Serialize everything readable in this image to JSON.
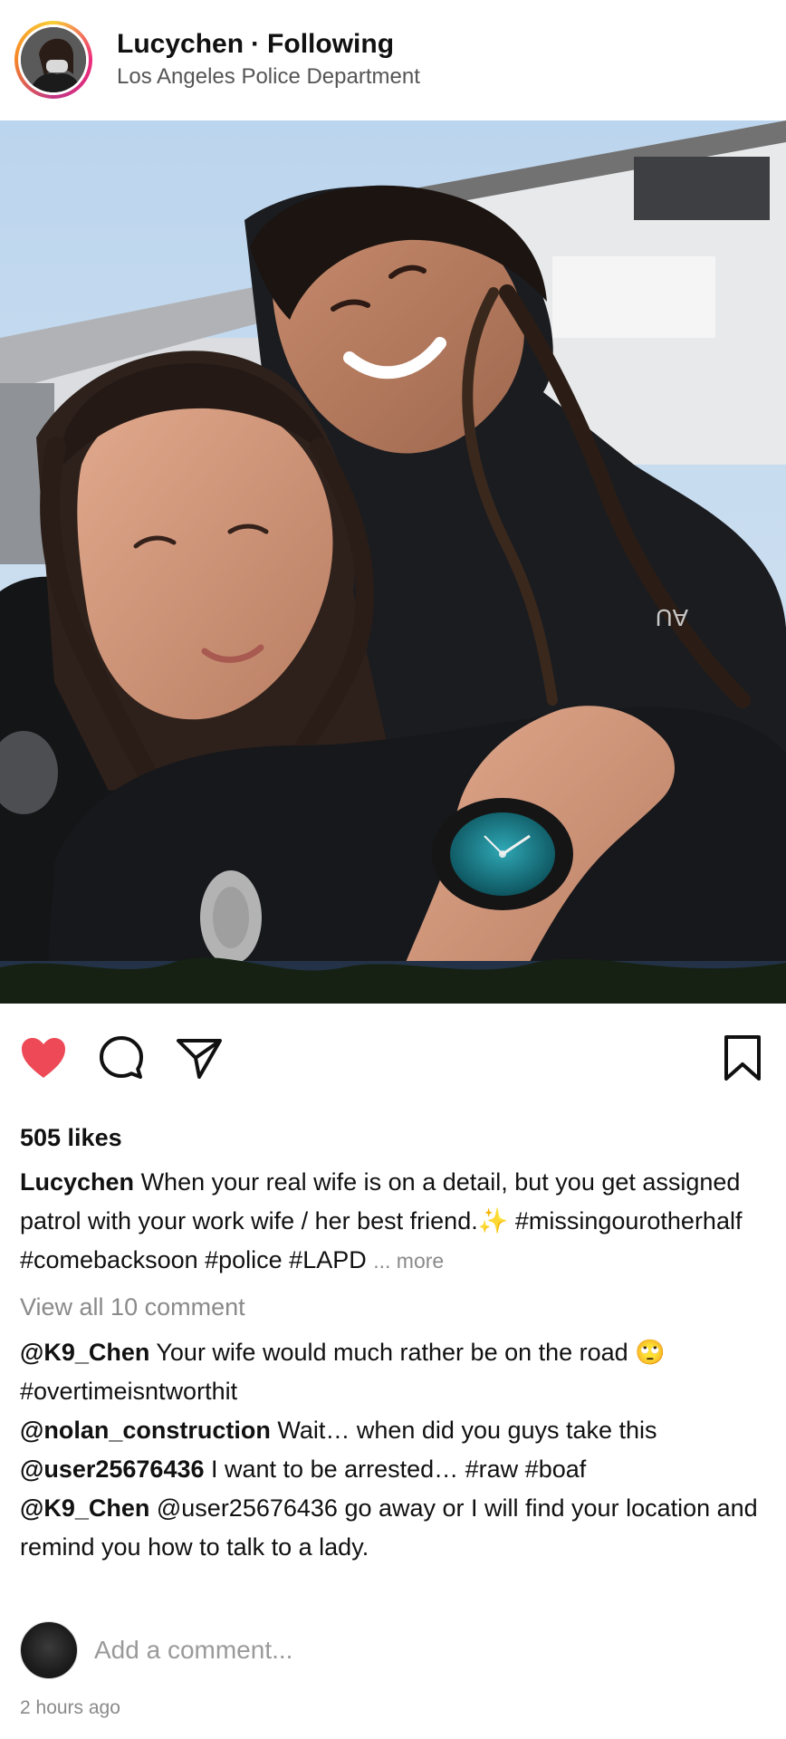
{
  "post_header": {
    "username": "Lucychen",
    "separator": "·",
    "follow_status": "Following",
    "location": "Los Angeles Police Department"
  },
  "actions": {
    "like_icon": "heart-filled-icon",
    "comment_icon": "comment-bubble-icon",
    "share_icon": "paper-plane-icon",
    "save_icon": "bookmark-icon",
    "like_color": "#ed4956"
  },
  "post": {
    "likes": "505 likes",
    "caption_user": "Lucychen",
    "caption_text": "When your real wife is on a detail, but you get assigned patrol with your work wife / her best friend.✨ #missingourotherhalf #comebacksoon #police #LAPD",
    "caption_more": "... more",
    "view_all_comments": "View all 10 comment",
    "comments": [
      {
        "user": "@K9_Chen",
        "text": "Your wife would much rather be on the road 🙄 #overtimeisntworthit"
      },
      {
        "user": "@nolan_construction",
        "text": "Wait… when did you guys take this"
      },
      {
        "user": "@user25676436",
        "text": "I want to be arrested… #raw #boaf"
      },
      {
        "user": "@K9_Chen",
        "text": "@user25676436 go away or I will find your location and remind you how to talk to a lady."
      }
    ],
    "add_comment_placeholder": "Add a comment...",
    "timestamp": "2 hours ago"
  }
}
